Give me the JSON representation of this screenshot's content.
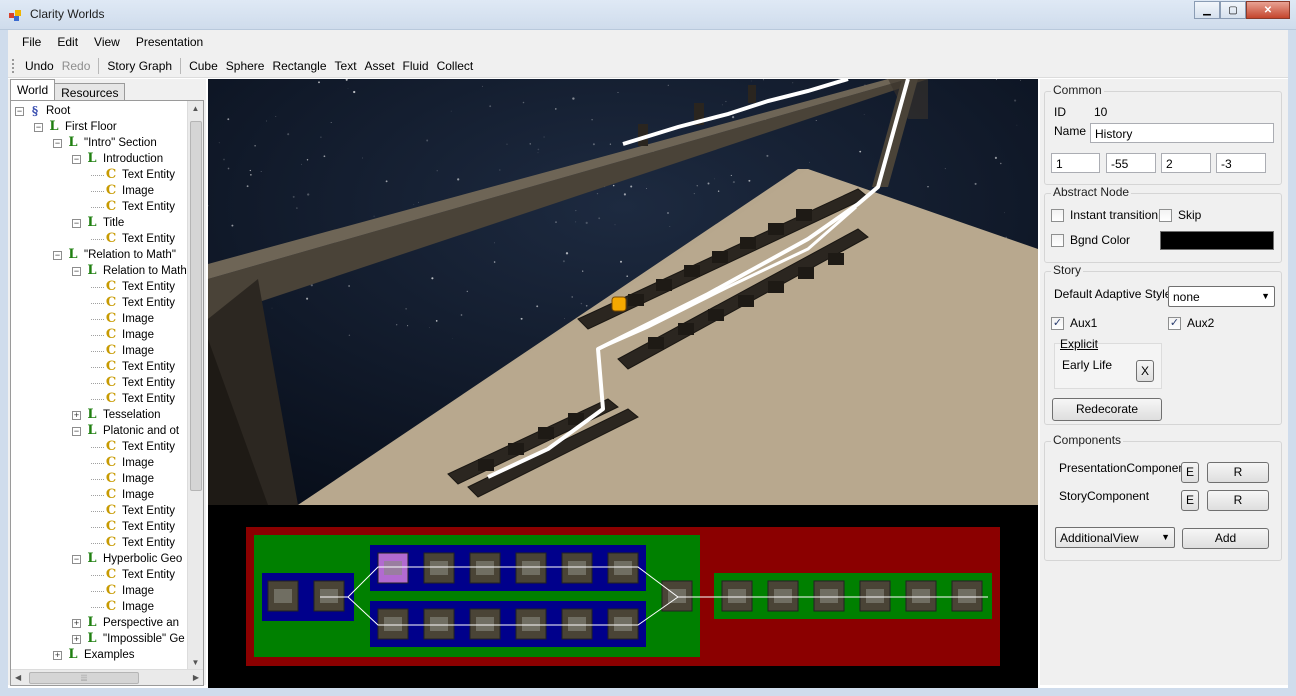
{
  "window": {
    "title": "Clarity Worlds"
  },
  "menu": [
    "File",
    "Edit",
    "View",
    "Presentation"
  ],
  "toolbar": {
    "undo": "Undo",
    "redo": "Redo",
    "story_graph": "Story Graph",
    "cube": "Cube",
    "sphere": "Sphere",
    "rectangle": "Rectangle",
    "text": "Text",
    "asset": "Asset",
    "fluid": "Fluid",
    "collect": "Collect"
  },
  "left_tabs": {
    "world": "World",
    "resources": "Resources"
  },
  "tree": [
    {
      "label": "Root",
      "indent": 0,
      "exp": "-",
      "icon": "root"
    },
    {
      "label": "First Floor",
      "indent": 1,
      "exp": "-",
      "icon": "l"
    },
    {
      "label": "\"Intro\" Section",
      "indent": 2,
      "exp": "-",
      "icon": "l"
    },
    {
      "label": "Introduction",
      "indent": 3,
      "exp": "-",
      "icon": "l"
    },
    {
      "label": "Text Entity",
      "indent": 4,
      "exp": "",
      "icon": "c"
    },
    {
      "label": "Image",
      "indent": 4,
      "exp": "",
      "icon": "c"
    },
    {
      "label": "Text Entity",
      "indent": 4,
      "exp": "",
      "icon": "c"
    },
    {
      "label": "Title",
      "indent": 3,
      "exp": "-",
      "icon": "l"
    },
    {
      "label": "Text Entity",
      "indent": 4,
      "exp": "",
      "icon": "c"
    },
    {
      "label": "\"Relation to Math\"",
      "indent": 2,
      "exp": "-",
      "icon": "l"
    },
    {
      "label": "Relation to Math",
      "indent": 3,
      "exp": "-",
      "icon": "l"
    },
    {
      "label": "Text Entity",
      "indent": 4,
      "exp": "",
      "icon": "c"
    },
    {
      "label": "Text Entity",
      "indent": 4,
      "exp": "",
      "icon": "c"
    },
    {
      "label": "Image",
      "indent": 4,
      "exp": "",
      "icon": "c"
    },
    {
      "label": "Image",
      "indent": 4,
      "exp": "",
      "icon": "c"
    },
    {
      "label": "Image",
      "indent": 4,
      "exp": "",
      "icon": "c"
    },
    {
      "label": "Text Entity",
      "indent": 4,
      "exp": "",
      "icon": "c"
    },
    {
      "label": "Text Entity",
      "indent": 4,
      "exp": "",
      "icon": "c"
    },
    {
      "label": "Text Entity",
      "indent": 4,
      "exp": "",
      "icon": "c"
    },
    {
      "label": "Tesselation",
      "indent": 3,
      "exp": "+",
      "icon": "l"
    },
    {
      "label": "Platonic and ot",
      "indent": 3,
      "exp": "-",
      "icon": "l"
    },
    {
      "label": "Text Entity",
      "indent": 4,
      "exp": "",
      "icon": "c"
    },
    {
      "label": "Image",
      "indent": 4,
      "exp": "",
      "icon": "c"
    },
    {
      "label": "Image",
      "indent": 4,
      "exp": "",
      "icon": "c"
    },
    {
      "label": "Image",
      "indent": 4,
      "exp": "",
      "icon": "c"
    },
    {
      "label": "Text Entity",
      "indent": 4,
      "exp": "",
      "icon": "c"
    },
    {
      "label": "Text Entity",
      "indent": 4,
      "exp": "",
      "icon": "c"
    },
    {
      "label": "Text Entity",
      "indent": 4,
      "exp": "",
      "icon": "c"
    },
    {
      "label": "Hyperbolic Geo",
      "indent": 3,
      "exp": "-",
      "icon": "l"
    },
    {
      "label": "Text Entity",
      "indent": 4,
      "exp": "",
      "icon": "c"
    },
    {
      "label": "Image",
      "indent": 4,
      "exp": "",
      "icon": "c"
    },
    {
      "label": "Image",
      "indent": 4,
      "exp": "",
      "icon": "c"
    },
    {
      "label": "Perspective an",
      "indent": 3,
      "exp": "+",
      "icon": "l"
    },
    {
      "label": "\"Impossible\" Ge",
      "indent": 3,
      "exp": "+",
      "icon": "l"
    },
    {
      "label": "Examples",
      "indent": 2,
      "exp": "+",
      "icon": "l"
    }
  ],
  "common": {
    "label": "Common",
    "id_label": "ID",
    "id_value": "10",
    "name_label": "Name",
    "name_value": "History",
    "coords": [
      "1",
      "-55",
      "2",
      "-3"
    ]
  },
  "abstract_node": {
    "label": "Abstract Node",
    "instant_transition": "Instant transition",
    "skip": "Skip",
    "bgnd_color": "Bgnd Color",
    "bgnd_color_value": "#000000"
  },
  "story": {
    "label": "Story",
    "default_adaptive_style": "Default Adaptive Style",
    "style_value": "none",
    "aux1": "Aux1",
    "aux2": "Aux2",
    "explicit": "Explicit",
    "early_life": "Early Life",
    "x_button": "X",
    "redecorate": "Redecorate"
  },
  "components": {
    "label": "Components",
    "items": [
      {
        "name": "PresentationComponent",
        "e": "E",
        "r": "R"
      },
      {
        "name": "StoryComponent",
        "e": "E",
        "r": "R"
      }
    ],
    "add_select": "AdditionalView",
    "add_button": "Add"
  },
  "colors": {
    "graph_red": "#8b0000",
    "graph_green": "#008000",
    "graph_blue": "#00008b",
    "floor": "#b7a78d",
    "space": "#0a1424"
  }
}
